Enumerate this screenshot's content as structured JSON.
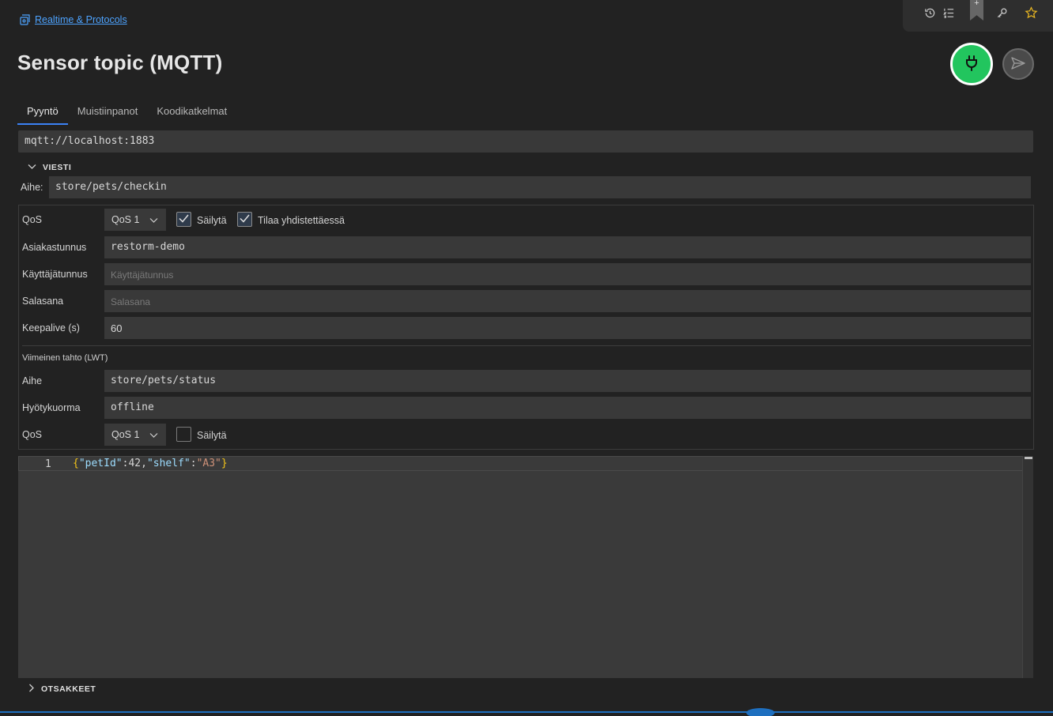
{
  "breadcrumb": {
    "label": "Realtime & Protocols",
    "icon": "protocols-icon"
  },
  "toolbar": {
    "icons": [
      "history-icon",
      "list-icon",
      "bookmark-icon",
      "key-icon",
      "star-icon"
    ],
    "bookmark_plus": "+"
  },
  "page": {
    "title": "Sensor topic (MQTT)"
  },
  "actions": {
    "connect_icon": "plug-icon",
    "connect_color": "#22c55e",
    "send_icon": "send-icon"
  },
  "tabs": [
    {
      "label": "Pyyntö",
      "active": true
    },
    {
      "label": "Muistiinpanot",
      "active": false
    },
    {
      "label": "Koodikatkelmat",
      "active": false
    }
  ],
  "url": "mqtt://localhost:1883",
  "message": {
    "section_label": "VIESTI",
    "topic_label": "Aihe:",
    "topic_value": "store/pets/checkin"
  },
  "settings": {
    "qos_label": "QoS",
    "qos_value": "QoS 1",
    "retain_label": "Säilytä",
    "retain_checked": true,
    "subscribe_label": "Tilaa yhdistettäessä",
    "subscribe_checked": true,
    "client_id_label": "Asiakastunnus",
    "client_id_value": "restorm-demo",
    "username_label": "Käyttäjätunnus",
    "username_placeholder": "Käyttäjätunnus",
    "password_label": "Salasana",
    "password_placeholder": "Salasana",
    "keepalive_label": "Keepalive (s)",
    "keepalive_value": "60"
  },
  "lwt": {
    "title": "Viimeinen tahto (LWT)",
    "topic_label": "Aihe",
    "topic_value": "store/pets/status",
    "payload_label": "Hyötykuorma",
    "payload_value": "offline",
    "qos_label": "QoS",
    "qos_value": "QoS 1",
    "retain_label": "Säilytä",
    "retain_checked": false
  },
  "editor": {
    "line_number": "1",
    "tokens": {
      "open": "{",
      "key1": "\"petId\"",
      "colon1": ":",
      "num1": "42",
      "comma": ",",
      "key2": "\"shelf\"",
      "colon2": ":",
      "str2": "\"A3\"",
      "close": "}"
    }
  },
  "headers": {
    "section_label": "OTSAKKEET"
  }
}
